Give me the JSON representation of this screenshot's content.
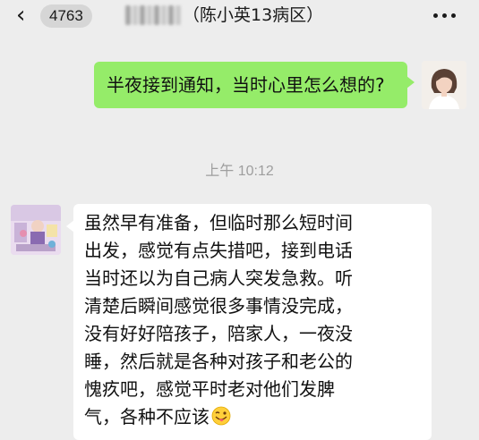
{
  "header": {
    "unread_count": "4763",
    "title": "（陈小英13病区）",
    "back_icon": "chevron-left-icon",
    "more_icon": "more-dots-icon"
  },
  "messages": {
    "outgoing": {
      "text": "半夜接到通知，当时心里怎么想的?"
    },
    "timestamp": "上午 10:12",
    "incoming": {
      "lines": [
        "虽然早有准备，但临时那么短时间",
        "出发，感觉有点失措吧，接到电话",
        "当时还以为自己病人突发急救。听",
        "清楚后瞬间感觉很多事情没完成，",
        "没有好好陪孩子，陪家人，一夜没",
        "睡，然后就是各种对孩子和老公的",
        "愧疚吧，感觉平时老对他们发脾",
        "气，各种不应该"
      ],
      "emoji": "tongue-wink-emoji"
    }
  },
  "colors": {
    "background": "#ededed",
    "outgoing_bubble": "#95ec69",
    "incoming_bubble": "#ffffff",
    "timestamp": "#9e9e9e"
  }
}
